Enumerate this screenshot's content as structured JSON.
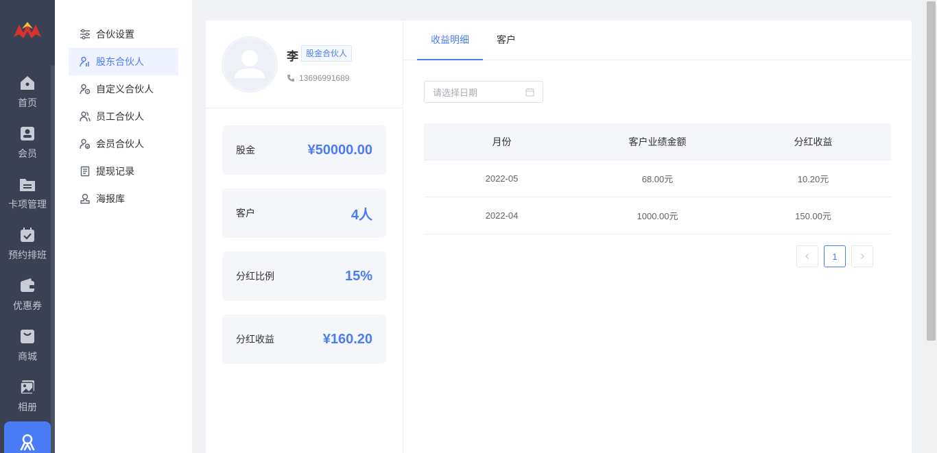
{
  "nav": {
    "items": [
      {
        "label": "首页",
        "icon": "home-icon"
      },
      {
        "label": "会员",
        "icon": "member-card-icon"
      },
      {
        "label": "卡项管理",
        "icon": "folder-icon"
      },
      {
        "label": "预约排班",
        "icon": "calendar-icon"
      },
      {
        "label": "优惠券",
        "icon": "wallet-icon"
      },
      {
        "label": "商城",
        "icon": "shopping-bag-icon"
      },
      {
        "label": "相册",
        "icon": "album-icon"
      }
    ],
    "active_icon": "partner-icon"
  },
  "submenu": {
    "items": [
      {
        "label": "合伙设置",
        "icon": "settings-sliders-icon"
      },
      {
        "label": "股东合伙人",
        "icon": "shareholder-icon"
      },
      {
        "label": "自定义合伙人",
        "icon": "custom-partner-icon"
      },
      {
        "label": "员工合伙人",
        "icon": "staff-partner-icon"
      },
      {
        "label": "会员合伙人",
        "icon": "member-partner-icon"
      },
      {
        "label": "提现记录",
        "icon": "document-icon"
      },
      {
        "label": "海报库",
        "icon": "stamp-icon"
      }
    ],
    "active_index": 1
  },
  "profile": {
    "name": "李",
    "tag": "股金合伙人",
    "phone": "13696991689",
    "stats": [
      {
        "label": "股金",
        "value": "¥50000.00"
      },
      {
        "label": "客户",
        "value": "4人"
      },
      {
        "label": "分红比例",
        "value": "15%"
      },
      {
        "label": "分红收益",
        "value": "¥160.20"
      }
    ]
  },
  "main": {
    "tabs": [
      {
        "label": "收益明细"
      },
      {
        "label": "客户"
      }
    ],
    "date_placeholder": "请选择日期",
    "table": {
      "headers": [
        "月份",
        "客户业绩金额",
        "分红收益"
      ],
      "rows": [
        [
          "2022-05",
          "68.00元",
          "10.20元"
        ],
        [
          "2022-04",
          "1000.00元",
          "150.00元"
        ]
      ]
    },
    "pagination": {
      "current": "1"
    }
  },
  "colors": {
    "accent": "#4a7cf6",
    "rail_bg": "#3a4152",
    "page_bg": "#f0f2f5"
  }
}
